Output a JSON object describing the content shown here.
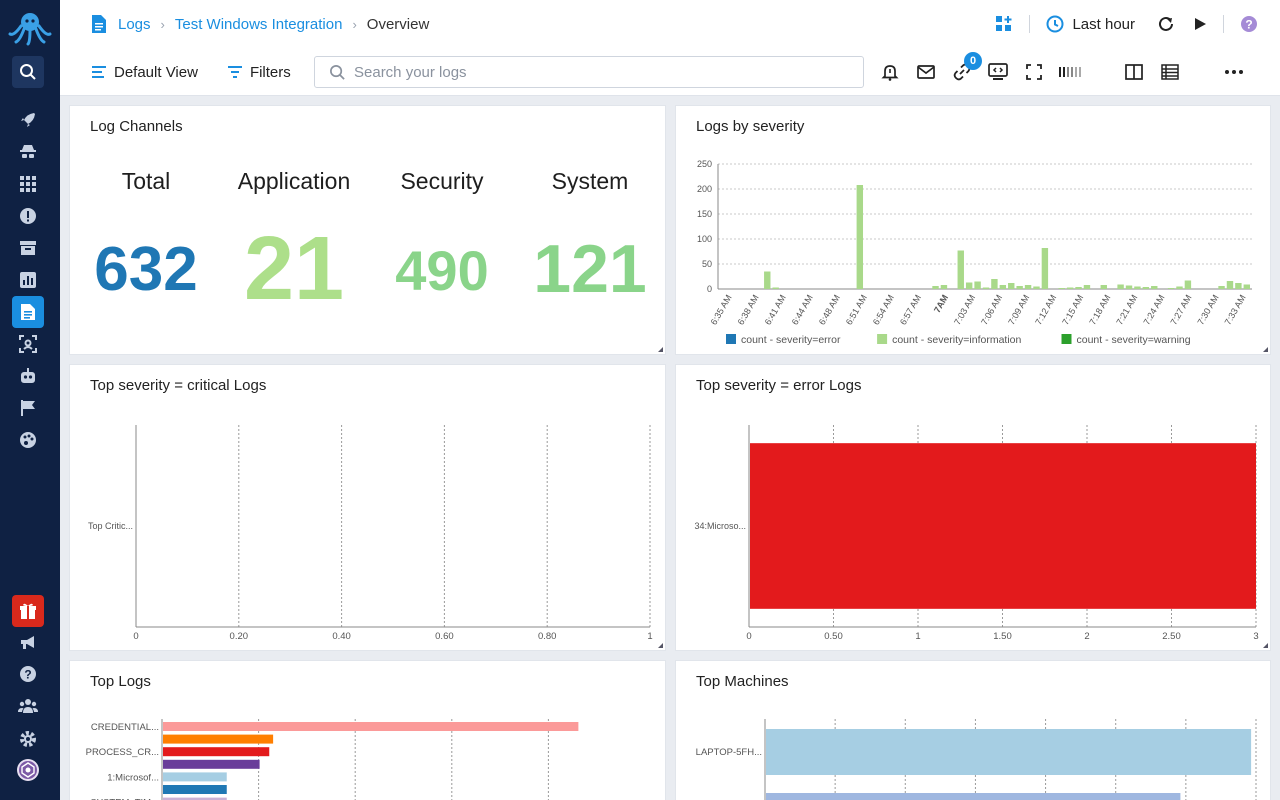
{
  "breadcrumb": {
    "root": "Logs",
    "parent": "Test Windows Integration",
    "current": "Overview"
  },
  "header": {
    "time_range": "Last hour"
  },
  "toolbar": {
    "default_view": "Default View",
    "filters": "Filters",
    "search_placeholder": "Search your logs",
    "connections_count": "0"
  },
  "colors": {
    "accent": "#1a8ee0",
    "rail_bg": "#0f2143",
    "error": "#1f77b4",
    "information": "#a9d98a",
    "warning": "#2ca02c",
    "critical_bar": "#e31a1c"
  },
  "panels": {
    "log_channels": {
      "title": "Log Channels",
      "items": [
        {
          "label": "Total",
          "value": "632",
          "color": "#1f77b4"
        },
        {
          "label": "Application",
          "value": "21",
          "color": "#addf8a"
        },
        {
          "label": "Security",
          "value": "490",
          "color": "#8ad48a"
        },
        {
          "label": "System",
          "value": "121",
          "color": "#8ad48a"
        }
      ]
    },
    "logs_by_severity": {
      "title": "Logs by severity"
    },
    "top_critical": {
      "title": "Top severity = critical Logs"
    },
    "top_error": {
      "title": "Top severity = error Logs"
    },
    "top_logs": {
      "title": "Top Logs"
    },
    "top_machines": {
      "title": "Top Machines"
    }
  },
  "chart_data": [
    {
      "type": "bar",
      "title": "Logs by severity",
      "ylim": [
        0,
        250
      ],
      "yticks": [
        "250",
        "200",
        "150",
        "100",
        "50",
        "0"
      ],
      "xticks": [
        "6:35 AM",
        "6:38 AM",
        "6:41 AM",
        "6:44 AM",
        "6:48 AM",
        "6:51 AM",
        "6:54 AM",
        "6:57 AM",
        "7AM",
        "7:03 AM",
        "7:06 AM",
        "7:09 AM",
        "7:12 AM",
        "7:15 AM",
        "7:18 AM",
        "7:21 AM",
        "7:24 AM",
        "7:27 AM",
        "7:30 AM",
        "7:33 AM"
      ],
      "legend": [
        "count - severity=error",
        "count - severity=information",
        "count - severity=warning"
      ],
      "series": [
        {
          "name": "count - severity=information",
          "values": [
            0,
            0,
            0,
            0,
            0,
            35,
            3,
            0,
            0,
            0,
            0,
            0,
            0,
            0,
            0,
            0,
            208,
            0,
            0,
            0,
            0,
            0,
            0,
            0,
            0,
            6,
            8,
            0,
            77,
            13,
            15,
            3,
            20,
            8,
            12,
            6,
            8,
            5,
            82,
            0,
            2,
            3,
            4,
            8,
            0,
            8,
            0,
            9,
            7,
            5,
            4,
            6,
            0,
            2,
            5,
            17,
            0,
            0,
            0,
            6,
            16,
            12,
            9
          ]
        },
        {
          "name": "count - severity=error",
          "values": []
        },
        {
          "name": "count - severity=warning",
          "values": []
        }
      ]
    },
    {
      "type": "bar",
      "title": "Top severity = critical Logs",
      "orientation": "horizontal",
      "categories": [
        "Top Critic..."
      ],
      "values": [
        0
      ],
      "xlim": [
        0,
        1
      ],
      "xticks": [
        "0",
        "0.20",
        "0.40",
        "0.60",
        "0.80",
        "1"
      ]
    },
    {
      "type": "bar",
      "title": "Top severity = error Logs",
      "orientation": "horizontal",
      "categories": [
        "34:Microso..."
      ],
      "values": [
        3
      ],
      "xlim": [
        0,
        3
      ],
      "xticks": [
        "0",
        "0.50",
        "1",
        "1.50",
        "2",
        "2.50",
        "3"
      ]
    },
    {
      "type": "bar",
      "title": "Top Logs",
      "orientation": "horizontal",
      "categories": [
        "CREDENTIAL...",
        "",
        "PROCESS_CR...",
        "",
        "1:Microsof...",
        "",
        "SYSTEM_TIM..."
      ],
      "values": [
        215,
        57,
        55,
        50,
        33,
        33,
        33
      ],
      "colors": [
        "#fb9a99",
        "#ff7f00",
        "#e31a1c",
        "#6a3d9a",
        "#a6cee3",
        "#1f78b4",
        "#cab2d6"
      ]
    },
    {
      "type": "bar",
      "title": "Top Machines",
      "orientation": "horizontal",
      "categories": [
        "LAPTOP-5FH...",
        ""
      ],
      "values": [
        247,
        211
      ],
      "colors": [
        "#a6cee3",
        "#9fb7e0"
      ]
    }
  ]
}
